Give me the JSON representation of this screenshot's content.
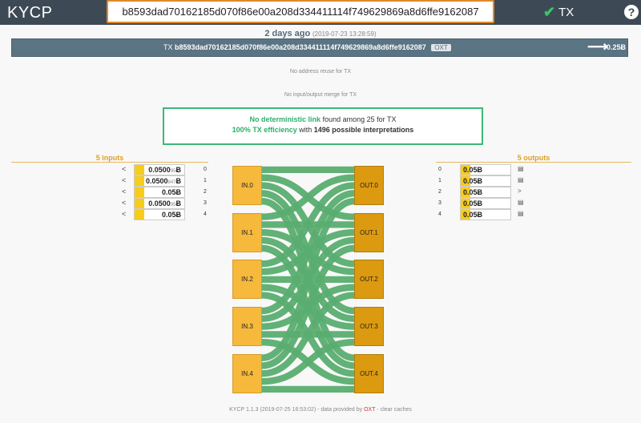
{
  "app": {
    "brand": "KYCP",
    "search_value": "b8593dad70162185d070f86e00a208d334411114f749629869a8d6ffe9162087",
    "nav_label": "TX",
    "help_label": "?"
  },
  "tx": {
    "age": "2 days ago",
    "date": "(2019-07-23 13:28:59)",
    "prefix": "TX",
    "hash": "b8593dad70162185d070f86e00a208d334411114f749629869a8d6ffe9162087",
    "tag": "OXT",
    "amount": "0.25Ƀ"
  },
  "notes": {
    "reuse": "No address reuse for TX",
    "merge": "No input/output merge for TX"
  },
  "verdict": {
    "link_bold": "No deterministic link",
    "link_rest": "found among 25 for TX",
    "eff_bold": "100% TX efficiency",
    "eff_mid": "with",
    "eff_count": "1496 possible interpretations"
  },
  "inputs": {
    "title": "5 inputs",
    "items": [
      {
        "value": "0.0500",
        "small": "95",
        "unit": "Ƀ",
        "index": "0",
        "fill": 0.2
      },
      {
        "value": "0.0500",
        "small": "847",
        "unit": "Ƀ",
        "index": "1",
        "fill": 0.2
      },
      {
        "value": "0.05",
        "small": "",
        "unit": "Ƀ",
        "index": "2",
        "fill": 0.2
      },
      {
        "value": "0.0500",
        "small": "95",
        "unit": "Ƀ",
        "index": "3",
        "fill": 0.2
      },
      {
        "value": "0.05",
        "small": "",
        "unit": "Ƀ",
        "index": "4",
        "fill": 0.2
      }
    ]
  },
  "outputs": {
    "title": "5 outputs",
    "items": [
      {
        "value": "0.05",
        "unit": "Ƀ",
        "index": "0",
        "fill": 0.2
      },
      {
        "value": "0.05",
        "unit": "Ƀ",
        "index": "1",
        "fill": 0.2
      },
      {
        "value": "0.05",
        "unit": "Ƀ",
        "index": "2",
        "fill": 0.2
      },
      {
        "value": "0.05",
        "unit": "Ƀ",
        "index": "3",
        "fill": 0.2
      },
      {
        "value": "0.05",
        "unit": "Ƀ",
        "index": "4",
        "fill": 0.2
      }
    ]
  },
  "graph": {
    "inputs": [
      "IN.0",
      "IN.1",
      "IN.2",
      "IN.3",
      "IN.4"
    ],
    "outputs": [
      "OUT.0",
      "OUT.1",
      "OUT.2",
      "OUT.3",
      "OUT.4"
    ],
    "link_color": "#5aad70"
  },
  "footer": {
    "version": "KYCP 1.1.3 (2019-07-25 16:53:02) - data provided by",
    "provider": "OXT",
    "sep": " - ",
    "clear": "clear caches"
  }
}
